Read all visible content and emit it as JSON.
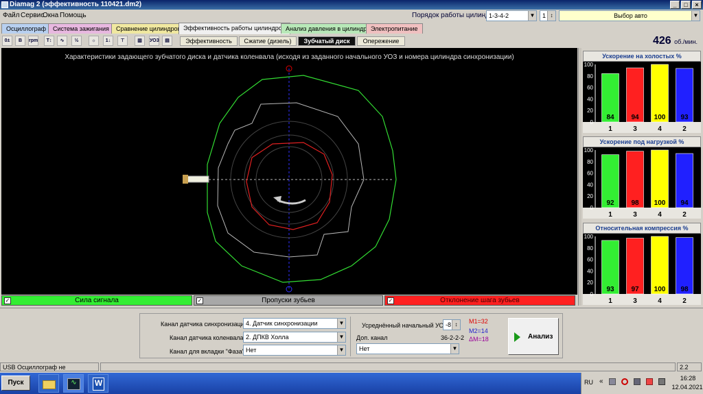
{
  "window": {
    "title": "Diamag 2 (эффективность 110421.dm2)"
  },
  "menu": [
    "Файл",
    "Сервис",
    "Окна",
    "Помощь"
  ],
  "cylinder_order": {
    "label": "Порядок работы цилиндров",
    "value": "1-3-4-2",
    "spin": "1"
  },
  "vehicle_select": "Выбор авто",
  "tabs": [
    "Осциллограф",
    "Система зажигания",
    "Сравнение цилиндров",
    "Эффективность работы цилиндров",
    "Анализ давления в цилиндре",
    "Электропитание"
  ],
  "tab_colors": [
    "#b8d0f0",
    "#e8b8e0",
    "#f0e8a0",
    "#f0f0f0",
    "#b8e8b8",
    "#f0c0c0"
  ],
  "subtabs": [
    "Эффективность",
    "Сжатие (дизель)",
    "Зубчатый диск",
    "Опережение"
  ],
  "active_subtab": "Зубчатый диск",
  "rpm": {
    "value": "426",
    "unit": "об./мин."
  },
  "plot": {
    "title": "Характеристики задающего зубчатого диска и датчика коленвала (исходя из заданного начального УОЗ и номера цилиндра синхронизации)"
  },
  "legend": [
    {
      "label": "Сила сигнала",
      "color": "#33ee33"
    },
    {
      "label": "Пропуски зубьев",
      "color": "#a8a8a8"
    },
    {
      "label": "Отклонение шага зубьев",
      "color": "#ff2020"
    }
  ],
  "bar_colors": [
    "#33ee33",
    "#ff2020",
    "#ffff00",
    "#2020ff"
  ],
  "chart_data": [
    {
      "type": "bar",
      "title": "Ускорение на холостых %",
      "categories": [
        "1",
        "3",
        "4",
        "2"
      ],
      "values": [
        84,
        94,
        100,
        93
      ],
      "ylim": [
        0,
        100
      ],
      "yticks": [
        "100",
        "80",
        "60",
        "40",
        "20",
        "0"
      ]
    },
    {
      "type": "bar",
      "title": "Ускорение под нагрузкой %",
      "categories": [
        "1",
        "3",
        "4",
        "2"
      ],
      "values": [
        92,
        98,
        100,
        94
      ],
      "ylim": [
        0,
        100
      ],
      "yticks": [
        "100",
        "80",
        "60",
        "40",
        "20",
        "0"
      ]
    },
    {
      "type": "bar",
      "title": "Относительная компрессия %",
      "categories": [
        "1",
        "3",
        "4",
        "2"
      ],
      "values": [
        93,
        97,
        100,
        98
      ],
      "ylim": [
        0,
        100
      ],
      "yticks": [
        "100",
        "80",
        "60",
        "40",
        "20",
        "0"
      ]
    }
  ],
  "bottom": {
    "sync_label": "Канал датчика синхронизации",
    "sync_value": "4. Датчик синхронизации",
    "crank_label": "Канал датчика коленвала",
    "crank_value": "2. ДПКВ Холла",
    "phase_label": "Канал для вкладки \"Фаза\"",
    "phase_value": "Нет",
    "uoz_label": "Усреднённый начальный УОЗ",
    "uoz_value": "-8",
    "m1": "M1=32",
    "m2": "M2=14",
    "dm": "ΔM=18",
    "extra_label": "Доп. канал",
    "extra_info": "36-2-2-2",
    "extra_value": "Нет",
    "analyze": "Анализ"
  },
  "status": {
    "left": "USB Осциллограф не подключен",
    "right": "2.2"
  },
  "taskbar": {
    "start": "Пуск",
    "lang": "RU",
    "time": "16:28",
    "date": "12.04.2021"
  }
}
